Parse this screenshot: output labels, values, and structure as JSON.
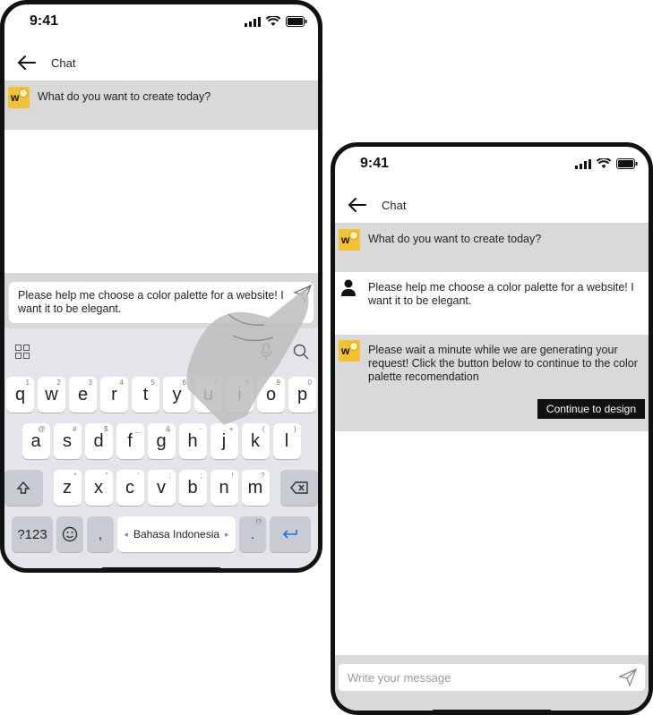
{
  "status": {
    "time": "9:41"
  },
  "header": {
    "title": "Chat"
  },
  "bot": {
    "avatar_letter": "w"
  },
  "phone1": {
    "messages": [
      "What do you want to create today?"
    ],
    "input_text": "Please help me choose a color palette for a website! I want it to be elegant."
  },
  "keyboard": {
    "row1": [
      {
        "k": "q",
        "s": "1"
      },
      {
        "k": "w",
        "s": "2"
      },
      {
        "k": "e",
        "s": "3"
      },
      {
        "k": "r",
        "s": "4"
      },
      {
        "k": "t",
        "s": "5"
      },
      {
        "k": "y",
        "s": "6"
      },
      {
        "k": "u",
        "s": "7"
      },
      {
        "k": "i",
        "s": "8"
      },
      {
        "k": "o",
        "s": "9"
      },
      {
        "k": "p",
        "s": "0"
      }
    ],
    "row2": [
      {
        "k": "a",
        "s": "@"
      },
      {
        "k": "s",
        "s": "#"
      },
      {
        "k": "d",
        "s": "$"
      },
      {
        "k": "f",
        "s": "_"
      },
      {
        "k": "g",
        "s": "&"
      },
      {
        "k": "h",
        "s": "-"
      },
      {
        "k": "j",
        "s": "+"
      },
      {
        "k": "k",
        "s": "("
      },
      {
        "k": "l",
        "s": ")"
      }
    ],
    "row3": [
      {
        "k": "z",
        "s": "*"
      },
      {
        "k": "x",
        "s": "\""
      },
      {
        "k": "c",
        "s": "'"
      },
      {
        "k": "v",
        "s": ":"
      },
      {
        "k": "b",
        "s": ";"
      },
      {
        "k": "n",
        "s": "!"
      },
      {
        "k": "m",
        "s": "?"
      }
    ],
    "symbols_label": "?123",
    "comma": ",",
    "space_label": "Bahasa Indonesia",
    "period": ".",
    "period_sup": "!?"
  },
  "phone2": {
    "bot_greeting": "What do you want to create today?",
    "user_message": "Please help me choose a color palette for a website! I want it to be elegant.",
    "bot_reply": "Please wait a minute while we are generating your request! Click the button below to continue to the color palette recomendation",
    "cta_label": "Continue to design",
    "input_placeholder": "Write your message"
  }
}
